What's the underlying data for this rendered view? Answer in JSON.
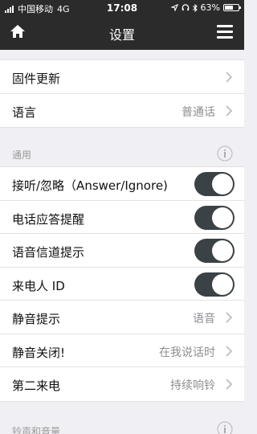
{
  "status_bar": {
    "carrier": "中国移动",
    "network": "4G",
    "time": "17:08",
    "battery": "63%"
  },
  "header": {
    "title": "设置"
  },
  "groups": {
    "top": [
      {
        "label": "固件更新",
        "value": ""
      },
      {
        "label": "语言",
        "value": "普通话"
      }
    ],
    "general": {
      "title": "通用",
      "items": [
        {
          "label": "接听/忽略（Answer/Ignore)",
          "toggle": true
        },
        {
          "label": "电话应答提醒",
          "toggle": true
        },
        {
          "label": "语音信道提示",
          "toggle": true
        },
        {
          "label": "来电人 ID",
          "toggle": true
        },
        {
          "label": "静音提示",
          "value": "语音"
        },
        {
          "label": "静音关闭!",
          "value": "在我说话时"
        },
        {
          "label": "第二来电",
          "value": "持续响铃"
        }
      ]
    },
    "ringtone": {
      "title": "铃声和音量"
    }
  },
  "colors": {
    "header_bg": "#2b2b2b",
    "toggle_on": "#3b4245",
    "page_bg": "#efeff4"
  }
}
